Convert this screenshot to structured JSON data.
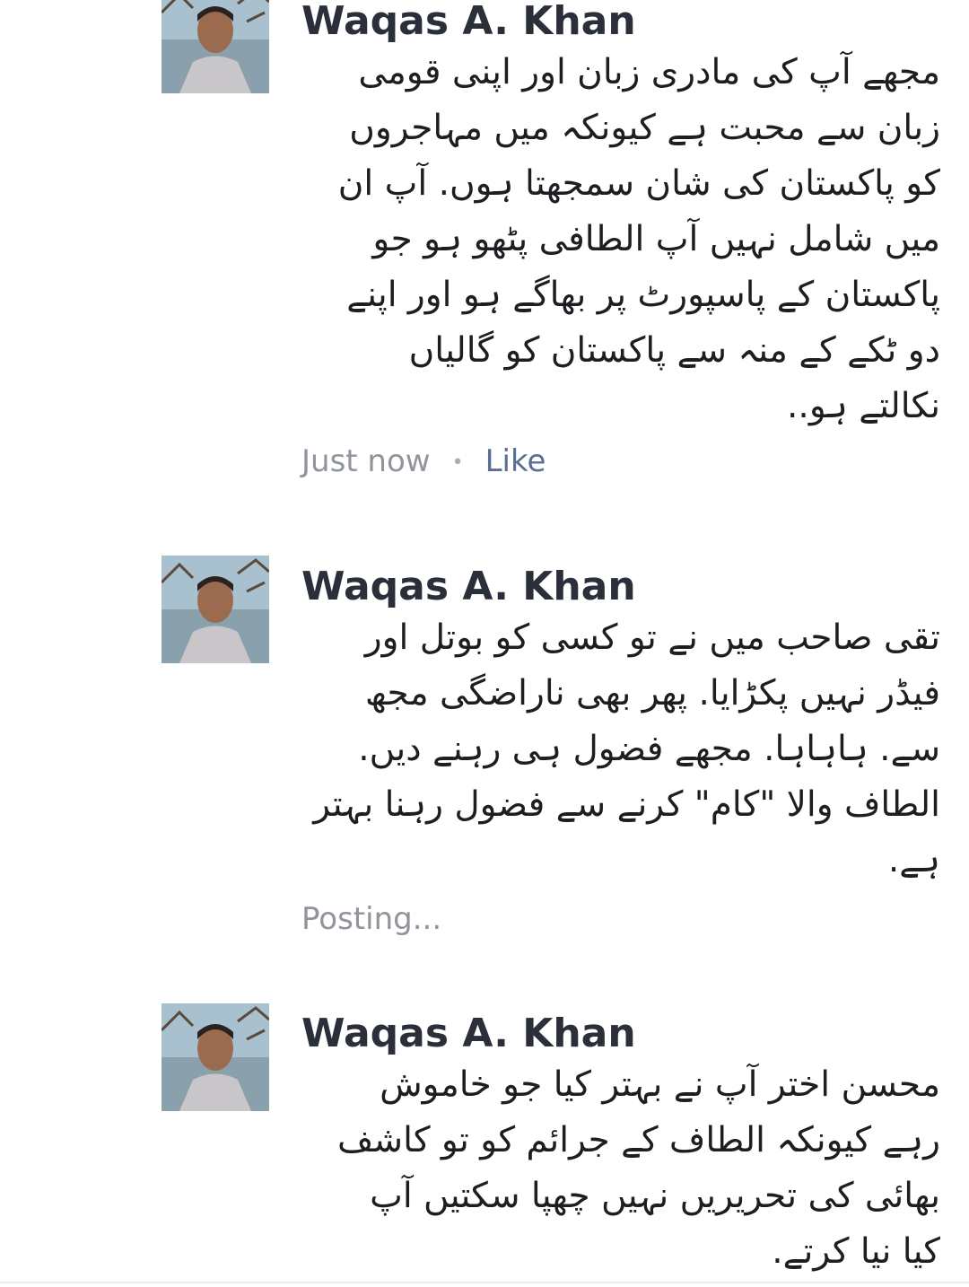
{
  "comments": [
    {
      "author": "Waqas A. Khan",
      "text": "مجھے آپ کی مادری زبان اور اپنی قومی\nزبان سے محبت ہے کیونکہ میں مہاجروں\nکو پاکستان کی شان سمجھتا ہوں. آپ ان\nمیں شامل نہیں آپ الطافی پٹھو ہو جو\nپاکستان کے پاسپورٹ پر بھاگے ہو اور اپنے\nدو ٹکے کے منہ سے پاکستان کو گالیاں\nنکالتے ہو..",
      "timestamp": "Just now",
      "separator": "•",
      "like_label": "Like"
    },
    {
      "author": "Waqas A. Khan",
      "text": "تقی صاحب میں نے تو کسی کو بوتل اور\nفیڈر نہیں پکڑایا. پھر بھی ناراضگی مجھ\nسے. ہاہاہا. مجھے فضول ہی رہنے دیں.\nالطاف والا \"کام\" کرنے سے فضول رہنا بہتر\nہے.",
      "status": "Posting..."
    },
    {
      "author": "Waqas A. Khan",
      "text": "محسن اختر آپ نے بہتر کیا جو خاموش\nرہے کیونکہ الطاف کے جرائم کو تو کاشف\nبھائی کی تحریریں نہیں چھپا سکتیں آپ\nکیا نیا کرتے."
    }
  ]
}
